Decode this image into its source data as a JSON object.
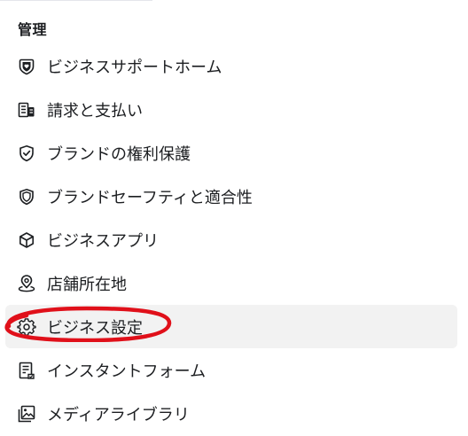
{
  "section_title": "管理",
  "menu": {
    "items": [
      {
        "label": "ビジネスサポートホーム",
        "icon": "shield-heart-icon"
      },
      {
        "label": "請求と支払い",
        "icon": "billing-icon"
      },
      {
        "label": "ブランドの権利保護",
        "icon": "shield-check-icon"
      },
      {
        "label": "ブランドセーフティと適合性",
        "icon": "shield-icon"
      },
      {
        "label": "ビジネスアプリ",
        "icon": "cube-icon"
      },
      {
        "label": "店舗所在地",
        "icon": "location-pin-icon"
      },
      {
        "label": "ビジネス設定",
        "icon": "gear-icon",
        "active": true
      },
      {
        "label": "インスタントフォーム",
        "icon": "form-icon"
      },
      {
        "label": "メディアライブラリ",
        "icon": "media-library-icon"
      }
    ]
  },
  "annotation": {
    "color": "#e0101a",
    "target": "ビジネス設定"
  },
  "colors": {
    "active_bg": "#f2f2f2",
    "text": "#1c1e21",
    "icon": "#1c1e21"
  }
}
